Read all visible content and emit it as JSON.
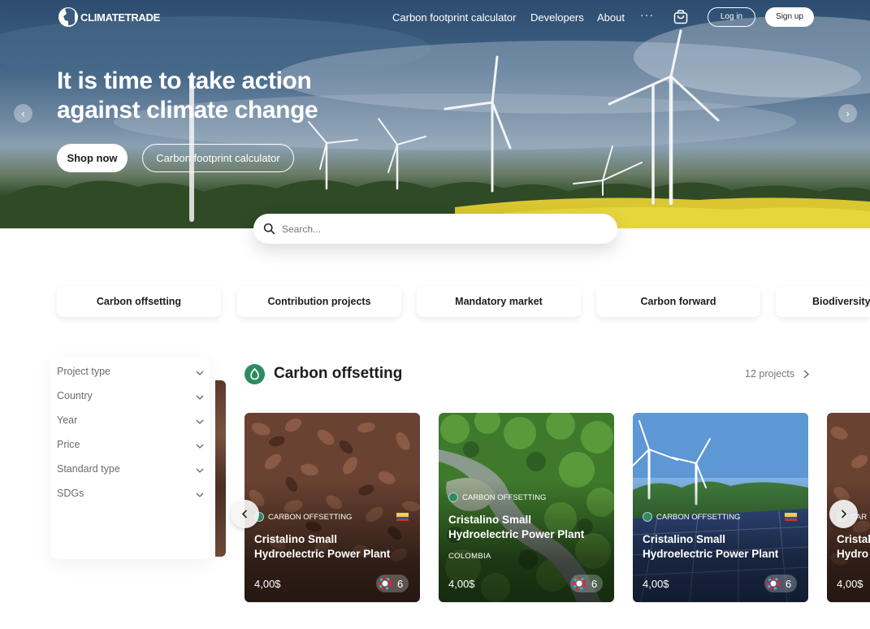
{
  "nav": {
    "logo_text": "CLIMATETRADE",
    "links": [
      "Carbon footprint calculator",
      "Developers",
      "About"
    ],
    "more": "···",
    "login": "Log in",
    "signup": "Sign up"
  },
  "hero": {
    "title_line1": "It is time to take action",
    "title_line2": "against climate change",
    "shop_now": "Shop now",
    "calculator": "Carbon footprint calculator"
  },
  "search": {
    "placeholder": "Search..."
  },
  "categories": [
    "Carbon offsetting",
    "Contribution projects",
    "Mandatory market",
    "Carbon forward",
    "Biodiversity"
  ],
  "filters": [
    "Project type",
    "Country",
    "Year",
    "Price",
    "Standard type",
    "SDGs"
  ],
  "section": {
    "title": "Carbon offsetting",
    "count": "12 projects"
  },
  "cards": [
    {
      "badge": "CARBON OFFSETTING",
      "title_line1": "Cristalino Small",
      "title_line2": "Hydroelectric Power Plant",
      "price": "4,00$",
      "sdg_count": "6"
    },
    {
      "badge": "CARBON OFFSETTING",
      "title_line1": "Cristalino Small",
      "title_line2": "Hydroelectric Power Plant",
      "country": "COLOMBIA",
      "price": "4,00$",
      "sdg_count": "6"
    },
    {
      "badge": "CARBON OFFSETTING",
      "title_line1": "Cristalino Small",
      "title_line2": "Hydroelectric Power Plant",
      "price": "4,00$",
      "sdg_count": "6"
    },
    {
      "badge": "CAR",
      "title_line1": "Cristal",
      "title_line2": "Hydro",
      "price": "4,00$"
    }
  ],
  "colors": {
    "brand_green": "#2e8a5f",
    "text_dark": "#1d1d1f",
    "text_muted": "#6b6b6b"
  }
}
